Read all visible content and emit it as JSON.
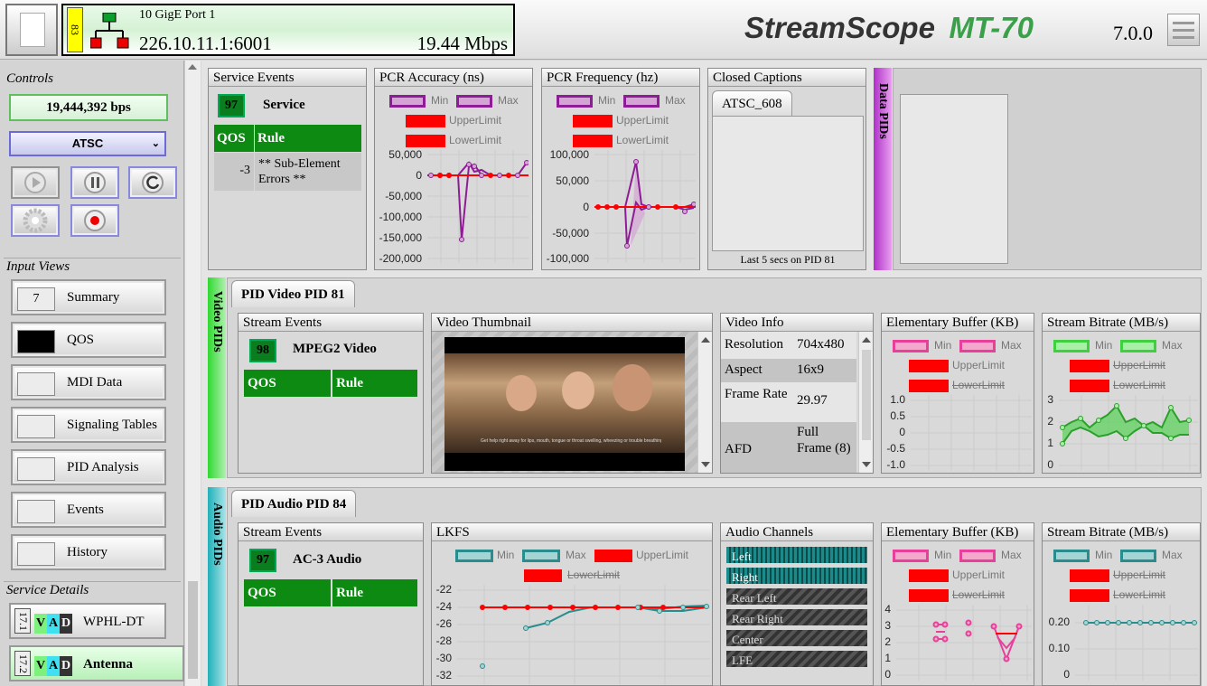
{
  "header": {
    "port_name": "10 GigE Port 1",
    "address": "226.10.11.1:6001",
    "bitrate": "19.44 Mbps",
    "badge": "83",
    "logo_text": "StreamScope",
    "logo_model": "MT-70",
    "version": "7.0.0"
  },
  "controls": {
    "title": "Controls",
    "bps": "19,444,392 bps",
    "standard": "ATSC"
  },
  "input_views": {
    "title": "Input Views",
    "items": [
      {
        "label": "Summary",
        "count": "7"
      },
      {
        "label": "QOS",
        "count": ""
      },
      {
        "label": "MDI Data",
        "count": ""
      },
      {
        "label": "Signaling Tables",
        "count": ""
      },
      {
        "label": "PID Analysis",
        "count": ""
      },
      {
        "label": "Events",
        "count": ""
      },
      {
        "label": "History",
        "count": ""
      }
    ]
  },
  "service_details": {
    "title": "Service Details",
    "services": [
      {
        "num": "17.1",
        "v": "V",
        "a": "A",
        "d": "D",
        "name": "WPHL-DT"
      },
      {
        "num": "17.2",
        "v": "V",
        "a": "A",
        "d": "D",
        "name": "Antenna"
      }
    ]
  },
  "service_events": {
    "title": "Service Events",
    "count": "97",
    "name": "Service",
    "qos": "QOS",
    "rule": "Rule",
    "value": "-3",
    "rule_text": "** Sub-Element Errors **"
  },
  "pcr_accuracy": {
    "title": "PCR Accuracy (ns)",
    "legend": [
      "Min",
      "Max",
      "UpperLimit",
      "LowerLimit"
    ],
    "ticks": [
      "50,000",
      "0",
      "-50,000",
      "-100,000",
      "-150,000",
      "-200,000"
    ]
  },
  "pcr_frequency": {
    "title": "PCR Frequency (hz)",
    "legend": [
      "Min",
      "Max",
      "UpperLimit",
      "LowerLimit"
    ],
    "ticks": [
      "100,000",
      "50,000",
      "0",
      "-50,000",
      "-100,000"
    ]
  },
  "closed_captions": {
    "title": "Closed Captions",
    "tab": "ATSC_608",
    "footer": "Last 5 secs on PID 81"
  },
  "data_pids": {
    "label": "Data PIDs"
  },
  "video": {
    "label": "Video PIDs",
    "tab": "PID Video PID 81",
    "events_title": "Stream Events",
    "count": "98",
    "stream_name": "MPEG2 Video",
    "qos": "QOS",
    "rule": "Rule",
    "thumb_title": "Video Thumbnail",
    "thumb_caption": "Get help right away for lips, mouth, tongue or throat swelling, wheezing or trouble breathing.",
    "info_title": "Video Info",
    "info": [
      {
        "k": "Resolution",
        "v": "704x480"
      },
      {
        "k": "Aspect",
        "v": "16x9"
      },
      {
        "k": "Frame Rate",
        "v": "29.97"
      },
      {
        "k": "AFD",
        "v": "Full Frame (8)"
      }
    ],
    "eb_title": "Elementary Buffer (KB)",
    "eb_ticks": [
      "1.0",
      "0.5",
      "0",
      "-0.5",
      "-1.0"
    ],
    "sb_title": "Stream Bitrate (MB/s)",
    "sb_ticks": [
      "3",
      "2",
      "1",
      "0"
    ],
    "legend": [
      "Min",
      "Max",
      "UpperLimit",
      "LowerLimit"
    ]
  },
  "audio": {
    "label": "Audio PIDs",
    "tab": "PID Audio PID 84",
    "events_title": "Stream Events",
    "count": "97",
    "stream_name": "AC-3 Audio",
    "qos": "QOS",
    "rule": "Rule",
    "lkfs_title": "LKFS",
    "lkfs_ticks": [
      "-22",
      "-24",
      "-26",
      "-28",
      "-30",
      "-32"
    ],
    "ch_title": "Audio Channels",
    "channels": [
      "Left",
      "Right",
      "Rear Left",
      "Rear Right",
      "Center",
      "LFE"
    ],
    "eb_title": "Elementary Buffer (KB)",
    "eb_ticks": [
      "4",
      "3",
      "2",
      "1",
      "0"
    ],
    "sb_title": "Stream Bitrate (MB/s)",
    "sb_ticks": [
      "0.20",
      "0.10",
      "0"
    ],
    "legend": [
      "Min",
      "Max",
      "UpperLimit",
      "LowerLimit"
    ]
  },
  "colors": {
    "green": "#0d8a12",
    "purple": "#8e1c96",
    "red": "#f00000",
    "teal": "#2a8c8c",
    "pink": "#e8409a",
    "lime": "#3fd03f"
  }
}
